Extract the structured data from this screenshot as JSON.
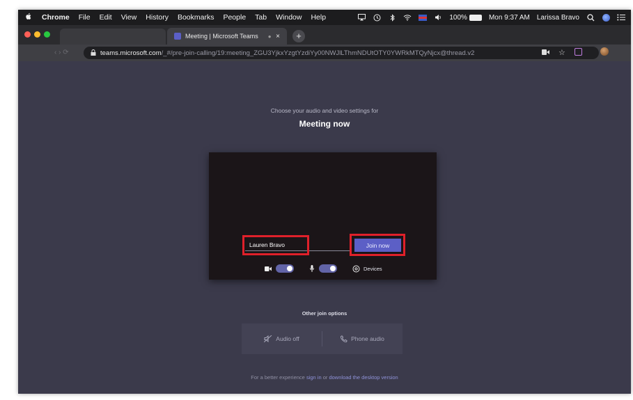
{
  "menubar": {
    "apple": "",
    "items": [
      "Chrome",
      "File",
      "Edit",
      "View",
      "History",
      "Bookmarks",
      "People",
      "Tab",
      "Window",
      "Help"
    ],
    "battery": "100%",
    "clock": "Mon 9:37 AM",
    "user": "Larissa Bravo"
  },
  "browser": {
    "tab_title": "Meeting | Microsoft Teams",
    "tab_close": "×",
    "new_tab": "+",
    "url_host": "teams.microsoft.com",
    "url_path": "/_#/pre-join-calling/19:meeting_ZGU3YjkxYzgtYzdiYy00NWJlLThmNDUtOTY0YWRkMTQyNjcx@thread.v2"
  },
  "page": {
    "subtitle": "Choose your audio and video settings for",
    "title": "Meeting now",
    "name_value": "Lauren Bravo",
    "join_label": "Join now",
    "devices_label": "Devices",
    "other_join_label": "Other join options",
    "audio_off_label": "Audio off",
    "phone_audio_label": "Phone audio",
    "footer_prefix": "For a better experience ",
    "footer_signin": "sign in",
    "footer_or": " or ",
    "footer_download": "download the desktop version"
  },
  "icons": {
    "camera": "camera-icon",
    "mic": "mic-icon",
    "settings": "gear-icon",
    "audio_off": "speaker-off-icon",
    "phone": "phone-icon"
  },
  "colors": {
    "accent": "#5c5fc6",
    "highlight": "#e0202a",
    "background": "#3b3a4b"
  },
  "toggles": {
    "camera_on": true,
    "mic_on": true
  }
}
